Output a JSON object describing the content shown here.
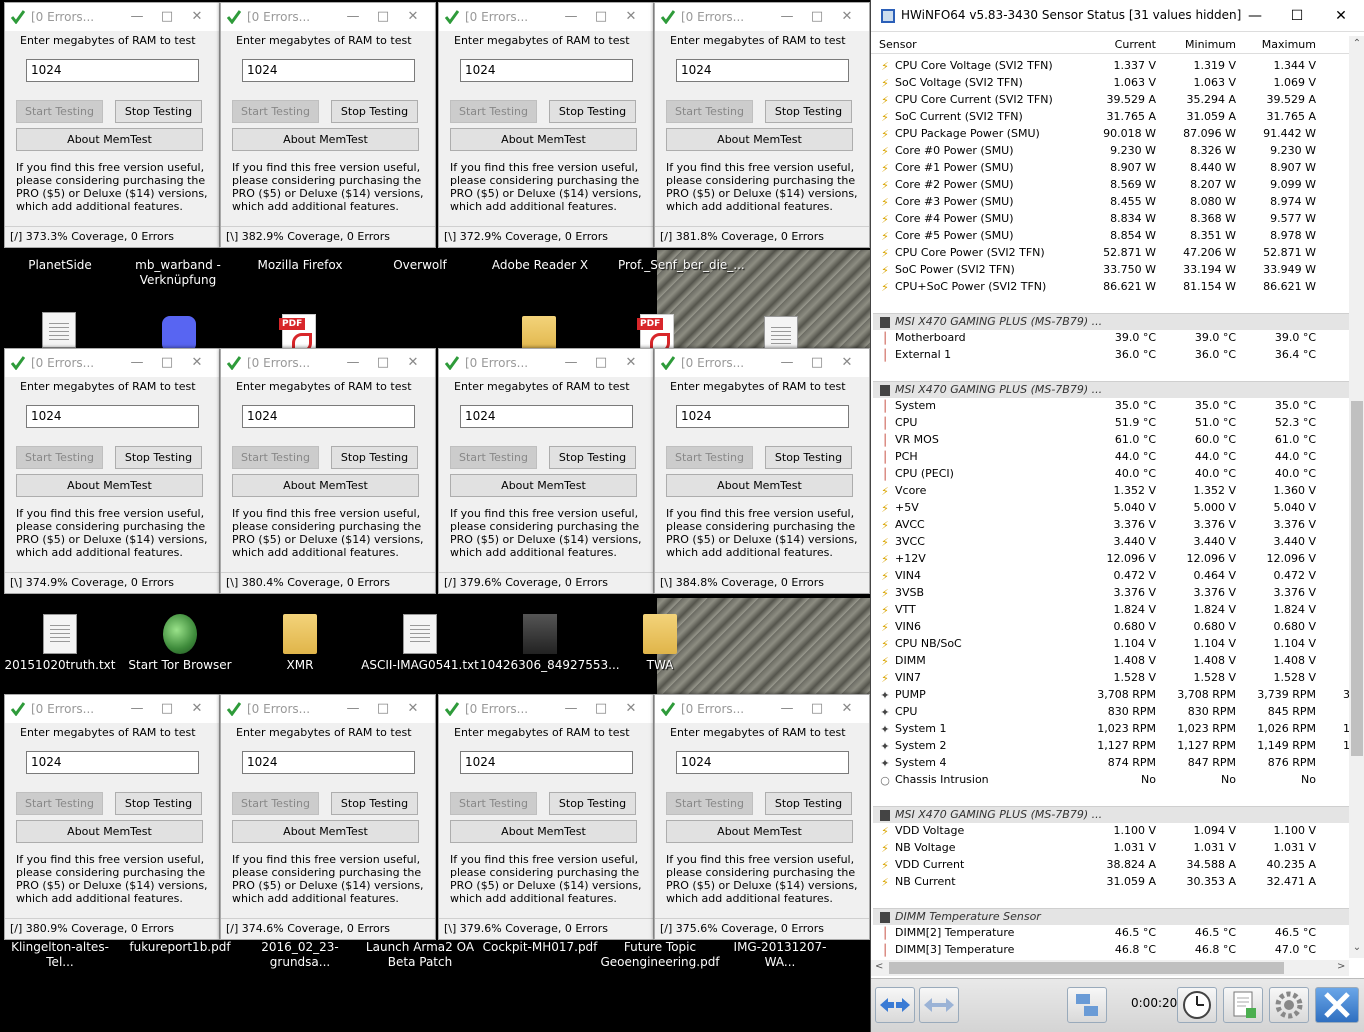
{
  "desktop": {
    "icons_row1": [
      {
        "label": "PlanetSide",
        "kind": "txt"
      },
      {
        "label": "mb_warband - Verknüpfung",
        "kind": "discord"
      },
      {
        "label": "Mozilla Firefox",
        "kind": "pdf"
      },
      {
        "label": "Overwolf",
        "kind": "txt"
      },
      {
        "label": "Adobe Reader X",
        "kind": "folder"
      },
      {
        "label": "Prof._Senf_ber_die_...",
        "kind": "pdf"
      }
    ],
    "icons_row2": [
      {
        "label": "20151020truth.txt",
        "kind": "txt"
      },
      {
        "label": "Start Tor Browser",
        "kind": "globe"
      },
      {
        "label": "XMR",
        "kind": "folder"
      },
      {
        "label": "ASCII-IMAG0541.txt",
        "kind": "txt"
      },
      {
        "label": "10426306_84927553...",
        "kind": "photo"
      },
      {
        "label": "TWA",
        "kind": "folder"
      }
    ],
    "icons_row3": [
      {
        "label": "Klingelton-altes-Tel...",
        "kind": "mp3"
      },
      {
        "label": "fukureport1b.pdf",
        "kind": "pdf"
      },
      {
        "label": "2016_02_23-grundsa...",
        "kind": "pdf"
      },
      {
        "label": "Launch Arma2 OA Beta Patch",
        "kind": "folder"
      },
      {
        "label": "Cockpit-MH017.pdf",
        "kind": "pdf"
      },
      {
        "label": "Future Topic Geoengineering.pdf",
        "kind": "pdf"
      },
      {
        "label": "IMG-20131207-WA...",
        "kind": "photo"
      }
    ]
  },
  "memtest": {
    "title": "[0 Errors...",
    "prompt": "Enter megabytes of RAM to test",
    "value": "1024",
    "start_label": "Start Testing",
    "stop_label": "Stop Testing",
    "about_label": "About MemTest",
    "info": "If you find this free version useful, please considering purchasing the PRO ($5) or Deluxe ($14) versions, which add additional features.",
    "windows": [
      {
        "status": "[/]   373.3% Coverage, 0 Errors"
      },
      {
        "status": "[\\]   382.9% Coverage, 0 Errors"
      },
      {
        "status": "[\\]   372.9% Coverage, 0 Errors"
      },
      {
        "status": "[/]   381.8% Coverage, 0 Errors"
      },
      {
        "status": "[\\]   374.9% Coverage, 0 Errors"
      },
      {
        "status": "[\\]   380.4% Coverage, 0 Errors"
      },
      {
        "status": "[/]   379.6% Coverage, 0 Errors"
      },
      {
        "status": "[\\]   384.8% Coverage, 0 Errors"
      },
      {
        "status": "[/]   380.9% Coverage, 0 Errors"
      },
      {
        "status": "[/]   374.6% Coverage, 0 Errors"
      },
      {
        "status": "[\\]   379.6% Coverage, 0 Errors"
      },
      {
        "status": "[/]   375.6% Coverage, 0 Errors"
      }
    ]
  },
  "hwinfo": {
    "title": "HWiNFO64 v5.83-3430 Sensor Status [31 values hidden]",
    "columns": {
      "sensor": "Sensor",
      "current": "Current",
      "minimum": "Minimum",
      "maximum": "Maximum"
    },
    "rows": [
      {
        "t": "bolt",
        "n": "CPU Core Voltage (SVI2 TFN)",
        "c": "1.337 V",
        "mi": "1.319 V",
        "ma": "1.344 V"
      },
      {
        "t": "bolt",
        "n": "SoC Voltage (SVI2 TFN)",
        "c": "1.063 V",
        "mi": "1.063 V",
        "ma": "1.069 V"
      },
      {
        "t": "bolt",
        "n": "CPU Core Current (SVI2 TFN)",
        "c": "39.529 A",
        "mi": "35.294 A",
        "ma": "39.529 A"
      },
      {
        "t": "bolt",
        "n": "SoC Current (SVI2 TFN)",
        "c": "31.765 A",
        "mi": "31.059 A",
        "ma": "31.765 A"
      },
      {
        "t": "bolt",
        "n": "CPU Package Power (SMU)",
        "c": "90.018 W",
        "mi": "87.096 W",
        "ma": "91.442 W"
      },
      {
        "t": "bolt",
        "n": "Core #0 Power (SMU)",
        "c": "9.230 W",
        "mi": "8.326 W",
        "ma": "9.230 W"
      },
      {
        "t": "bolt",
        "n": "Core #1 Power (SMU)",
        "c": "8.907 W",
        "mi": "8.440 W",
        "ma": "8.907 W"
      },
      {
        "t": "bolt",
        "n": "Core #2 Power (SMU)",
        "c": "8.569 W",
        "mi": "8.207 W",
        "ma": "9.099 W"
      },
      {
        "t": "bolt",
        "n": "Core #3 Power (SMU)",
        "c": "8.455 W",
        "mi": "8.080 W",
        "ma": "8.974 W"
      },
      {
        "t": "bolt",
        "n": "Core #4 Power (SMU)",
        "c": "8.834 W",
        "mi": "8.368 W",
        "ma": "9.577 W"
      },
      {
        "t": "bolt",
        "n": "Core #5 Power (SMU)",
        "c": "8.854 W",
        "mi": "8.351 W",
        "ma": "8.978 W"
      },
      {
        "t": "bolt",
        "n": "CPU Core Power (SVI2 TFN)",
        "c": "52.871 W",
        "mi": "47.206 W",
        "ma": "52.871 W"
      },
      {
        "t": "bolt",
        "n": "SoC Power (SVI2 TFN)",
        "c": "33.750 W",
        "mi": "33.194 W",
        "ma": "33.949 W"
      },
      {
        "t": "bolt",
        "n": "CPU+SoC Power (SVI2 TFN)",
        "c": "86.621 W",
        "mi": "81.154 W",
        "ma": "86.621 W"
      },
      {
        "t": "blank"
      },
      {
        "t": "group",
        "n": "MSI X470 GAMING PLUS (MS-7B79) ..."
      },
      {
        "t": "therm",
        "n": "Motherboard",
        "c": "39.0 °C",
        "mi": "39.0 °C",
        "ma": "39.0 °C"
      },
      {
        "t": "therm",
        "n": "External 1",
        "c": "36.0 °C",
        "mi": "36.0 °C",
        "ma": "36.4 °C"
      },
      {
        "t": "blank"
      },
      {
        "t": "group",
        "n": "MSI X470 GAMING PLUS (MS-7B79) ..."
      },
      {
        "t": "therm",
        "n": "System",
        "c": "35.0 °C",
        "mi": "35.0 °C",
        "ma": "35.0 °C"
      },
      {
        "t": "therm",
        "n": "CPU",
        "c": "51.9 °C",
        "mi": "51.0 °C",
        "ma": "52.3 °C"
      },
      {
        "t": "therm",
        "n": "VR MOS",
        "c": "61.0 °C",
        "mi": "60.0 °C",
        "ma": "61.0 °C"
      },
      {
        "t": "therm",
        "n": "PCH",
        "c": "44.0 °C",
        "mi": "44.0 °C",
        "ma": "44.0 °C"
      },
      {
        "t": "therm",
        "n": "CPU (PECI)",
        "c": "40.0 °C",
        "mi": "40.0 °C",
        "ma": "40.0 °C"
      },
      {
        "t": "bolt",
        "n": "Vcore",
        "c": "1.352 V",
        "mi": "1.352 V",
        "ma": "1.360 V"
      },
      {
        "t": "bolt",
        "n": "+5V",
        "c": "5.040 V",
        "mi": "5.000 V",
        "ma": "5.040 V"
      },
      {
        "t": "bolt",
        "n": "AVCC",
        "c": "3.376 V",
        "mi": "3.376 V",
        "ma": "3.376 V"
      },
      {
        "t": "bolt",
        "n": "3VCC",
        "c": "3.440 V",
        "mi": "3.440 V",
        "ma": "3.440 V"
      },
      {
        "t": "bolt",
        "n": "+12V",
        "c": "12.096 V",
        "mi": "12.096 V",
        "ma": "12.096 V"
      },
      {
        "t": "bolt",
        "n": "VIN4",
        "c": "0.472 V",
        "mi": "0.464 V",
        "ma": "0.472 V"
      },
      {
        "t": "bolt",
        "n": "3VSB",
        "c": "3.376 V",
        "mi": "3.376 V",
        "ma": "3.376 V"
      },
      {
        "t": "bolt",
        "n": "VTT",
        "c": "1.824 V",
        "mi": "1.824 V",
        "ma": "1.824 V"
      },
      {
        "t": "bolt",
        "n": "VIN6",
        "c": "0.680 V",
        "mi": "0.680 V",
        "ma": "0.680 V"
      },
      {
        "t": "bolt",
        "n": "CPU NB/SoC",
        "c": "1.104 V",
        "mi": "1.104 V",
        "ma": "1.104 V"
      },
      {
        "t": "bolt",
        "n": "DIMM",
        "c": "1.408 V",
        "mi": "1.408 V",
        "ma": "1.408 V"
      },
      {
        "t": "bolt",
        "n": "VIN7",
        "c": "1.528 V",
        "mi": "1.528 V",
        "ma": "1.528 V"
      },
      {
        "t": "fan",
        "n": "PUMP",
        "c": "3,708 RPM",
        "mi": "3,708 RPM",
        "ma": "3,739 RPM",
        "x": "3"
      },
      {
        "t": "fan",
        "n": "CPU",
        "c": "830 RPM",
        "mi": "830 RPM",
        "ma": "845 RPM"
      },
      {
        "t": "fan",
        "n": "System 1",
        "c": "1,023 RPM",
        "mi": "1,023 RPM",
        "ma": "1,026 RPM",
        "x": "1"
      },
      {
        "t": "fan",
        "n": "System 2",
        "c": "1,127 RPM",
        "mi": "1,127 RPM",
        "ma": "1,149 RPM",
        "x": "1"
      },
      {
        "t": "fan",
        "n": "System 4",
        "c": "874 RPM",
        "mi": "847 RPM",
        "ma": "876 RPM"
      },
      {
        "t": "circ",
        "n": "Chassis Intrusion",
        "c": "No",
        "mi": "No",
        "ma": "No"
      },
      {
        "t": "blank"
      },
      {
        "t": "group",
        "n": "MSI X470 GAMING PLUS (MS-7B79) ..."
      },
      {
        "t": "bolt",
        "n": "VDD Voltage",
        "c": "1.100 V",
        "mi": "1.094 V",
        "ma": "1.100 V"
      },
      {
        "t": "bolt",
        "n": "NB Voltage",
        "c": "1.031 V",
        "mi": "1.031 V",
        "ma": "1.031 V"
      },
      {
        "t": "bolt",
        "n": "VDD Current",
        "c": "38.824 A",
        "mi": "34.588 A",
        "ma": "40.235 A"
      },
      {
        "t": "bolt",
        "n": "NB Current",
        "c": "31.059 A",
        "mi": "30.353 A",
        "ma": "32.471 A"
      },
      {
        "t": "blank"
      },
      {
        "t": "group",
        "n": "DIMM Temperature Sensor"
      },
      {
        "t": "therm",
        "n": "DIMM[2] Temperature",
        "c": "46.5 °C",
        "mi": "46.5 °C",
        "ma": "46.5 °C"
      },
      {
        "t": "therm",
        "n": "DIMM[3] Temperature",
        "c": "46.8 °C",
        "mi": "46.8 °C",
        "ma": "47.0 °C"
      }
    ],
    "timer": "0:00:20"
  }
}
